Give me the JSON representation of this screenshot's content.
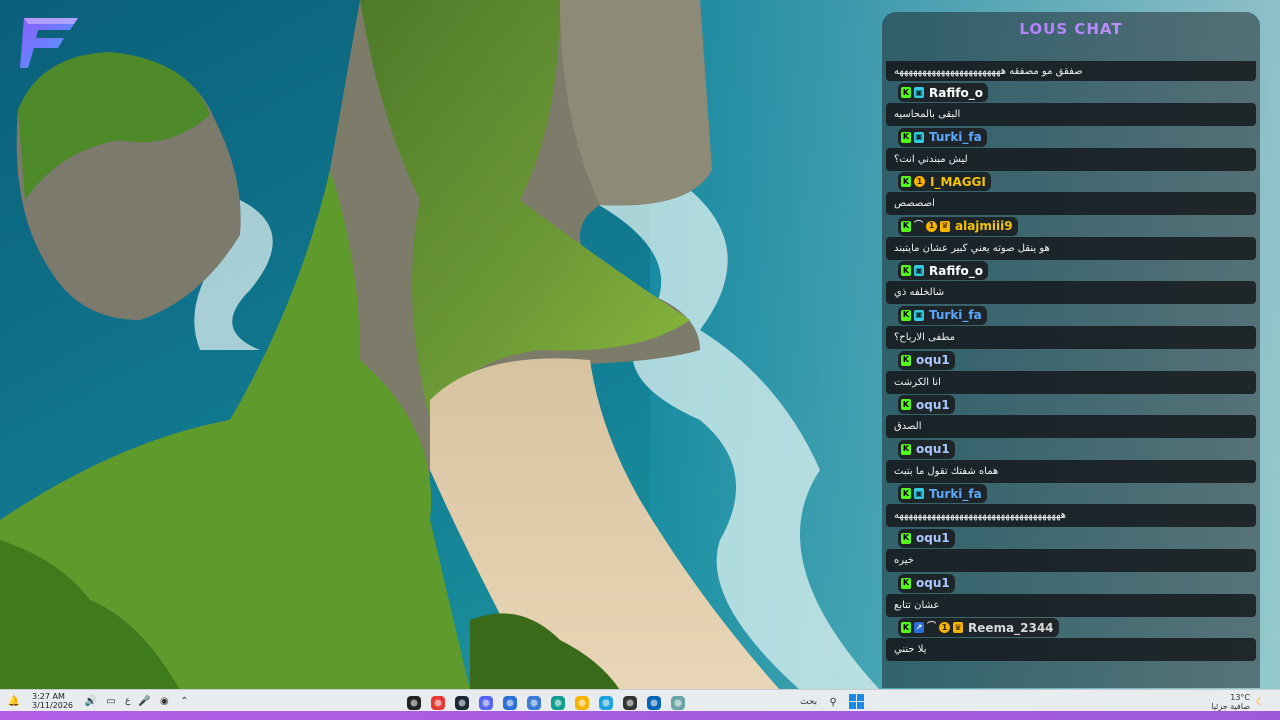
{
  "app_logo": {
    "icon": "stylized-F-logo",
    "colors": [
      "#8a5cff",
      "#4aa3ff"
    ]
  },
  "chat": {
    "title": "LOUS CHAT",
    "messages": [
      {
        "username": "",
        "badges": [],
        "text": "صفقق مو مصفقه هههههههههههههههههههههههه",
        "first": true
      },
      {
        "username": "Rafifo_o",
        "name_color": "#ffffff",
        "badges": [
          "kick",
          "sub"
        ],
        "text": "البقى بالمحاسيه"
      },
      {
        "username": "Turki_fa",
        "name_color": "#5aa9ff",
        "badges": [
          "kick",
          "sub"
        ],
        "text": "ليش مبندني انت؟"
      },
      {
        "username": "I_MAGGI",
        "name_color": "#f5c400",
        "badges": [
          "kick",
          "gifter"
        ],
        "text": "اصصصص"
      },
      {
        "username": "alajmiii9",
        "name_color": "#f5c400",
        "badges": [
          "kick",
          "moon",
          "gifter",
          "crown"
        ],
        "text": "هو ينقل صوته يعني كبير عشان مايتبند"
      },
      {
        "username": "Rafifo_o",
        "name_color": "#ffffff",
        "badges": [
          "kick",
          "sub"
        ],
        "text": "شالخلفه ذي"
      },
      {
        "username": "Turki_fa",
        "name_color": "#5aa9ff",
        "badges": [
          "kick",
          "sub"
        ],
        "text": "مطفى الارباح؟"
      },
      {
        "username": "oqu1",
        "name_color": "#a9c8ff",
        "badges": [
          "kick"
        ],
        "text": "انا الكرشت"
      },
      {
        "username": "oqu1",
        "name_color": "#a9c8ff",
        "badges": [
          "kick"
        ],
        "text": "الصدق"
      },
      {
        "username": "oqu1",
        "name_color": "#a9c8ff",
        "badges": [
          "kick"
        ],
        "text": "هماه شفتك تقول ما بتبث"
      },
      {
        "username": "Turki_fa",
        "name_color": "#5aa9ff",
        "badges": [
          "kick",
          "sub"
        ],
        "text": "ههههههههههههههههههههههههههههههههههههه"
      },
      {
        "username": "oqu1",
        "name_color": "#a9c8ff",
        "badges": [
          "kick"
        ],
        "text": "خيره"
      },
      {
        "username": "oqu1",
        "name_color": "#a9c8ff",
        "badges": [
          "kick"
        ],
        "text": "عشان تتابع"
      },
      {
        "username": "Reema_2344",
        "name_color": "#d9d9d9",
        "badges": [
          "kick",
          "og",
          "moon",
          "gifter",
          "crown"
        ],
        "text": "يلا حنني"
      }
    ]
  },
  "taskbar": {
    "clock_time": "3:27 AM",
    "clock_date": "3/11/2026",
    "language": "ع",
    "search_label": "بحث",
    "weather_temp": "13°C",
    "weather_desc": "صافية جزئيا",
    "tray_icons": [
      "notification-icon",
      "speaker-icon",
      "display-icon",
      "language-indicator",
      "microphone-icon",
      "network-icon",
      "chevron-up-icon"
    ],
    "apps": [
      {
        "name": "obs-icon",
        "color": "#222222"
      },
      {
        "name": "chrome-icon",
        "color": "#e53935"
      },
      {
        "name": "steam-icon",
        "color": "#1b2838"
      },
      {
        "name": "discord-icon",
        "color": "#5865f2"
      },
      {
        "name": "folder-app-icon",
        "color": "#2a6fd8"
      },
      {
        "name": "store-icon",
        "color": "#3a7bd5"
      },
      {
        "name": "edge-icon",
        "color": "#0f9d8f"
      },
      {
        "name": "file-explorer-icon",
        "color": "#f5b400"
      },
      {
        "name": "photos-icon",
        "color": "#1fa3e0"
      },
      {
        "name": "terminal-icon",
        "color": "#333333"
      },
      {
        "name": "outlook-icon",
        "color": "#0a64b6"
      },
      {
        "name": "wallpaper-app-icon",
        "color": "#6aa6a8"
      }
    ]
  }
}
